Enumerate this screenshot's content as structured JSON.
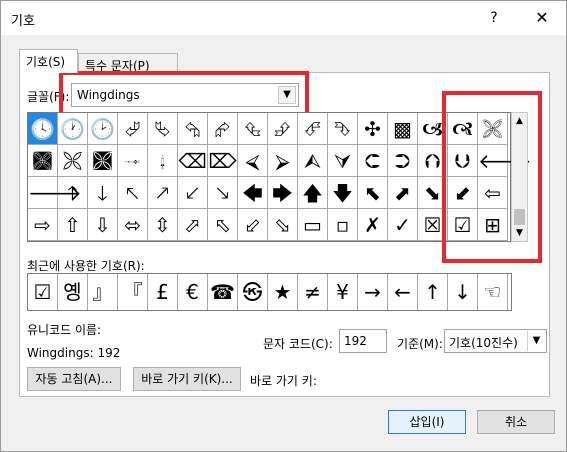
{
  "window": {
    "title": "기호",
    "help_label": "?",
    "close_label": "✕"
  },
  "tabs": [
    {
      "label": "기호(S)"
    },
    {
      "label": "특수 문자(P)"
    }
  ],
  "font": {
    "label": "글꼴(F):",
    "value": "Wingdings"
  },
  "symbol_grid": {
    "selected_index": 0,
    "rows": [
      [
        "🕓",
        "🕐",
        "🕑",
        "⮰",
        "⮱",
        "⮲",
        "⮳",
        "⮴",
        "⮵",
        "⮶",
        "⮷",
        "✣",
        "▩",
        "🙦",
        "🙧",
        "🙨"
      ],
      [
        "🙩",
        "🙪",
        "🙫",
        "🙬",
        "🙭",
        "⌫",
        "⌦",
        "⮘",
        "⮚",
        "⮙",
        "⮛",
        "⮈",
        "⮊",
        "⮉",
        "⮋",
        "🡐"
      ],
      [
        "🡒",
        "🡑",
        "🡓",
        "🡔",
        "🡕",
        "🡗",
        "🡖",
        "🡄",
        "🡆",
        "🡅",
        "🡇",
        "⬉",
        "⬈",
        "⬊",
        "⬋",
        "⇦"
      ],
      [
        "⇨",
        "⇧",
        "⇩",
        "⬄",
        "⇳",
        "⬀",
        "⬁",
        "⬃",
        "⬂",
        "▭",
        "▫",
        "✗",
        "✓",
        "☒",
        "☑",
        "⊞"
      ]
    ]
  },
  "recent": {
    "label": "최근에 사용한 기호(R):",
    "items": [
      "☑",
      "옝",
      "』",
      "『",
      "£",
      "€",
      "☎",
      "㉿",
      "★",
      "≠",
      "¥",
      "→",
      "←",
      "↑",
      "↓",
      "☜"
    ]
  },
  "unicode_name": {
    "label": "유니코드 이름:",
    "value": "Wingdings: 192"
  },
  "char_code": {
    "label": "문자 코드(C):",
    "value": "192"
  },
  "base": {
    "label": "기준(M):",
    "value": "기호(10진수)"
  },
  "buttons": {
    "autocorrect": "자동 고침(A)...",
    "shortcut_key": "바로 가기 키(K)...",
    "shortcut_label": "바로 가기 키:",
    "insert": "삽입(I)",
    "cancel": "취소"
  },
  "colors": {
    "highlight": "#e8282c",
    "selection": "#1e88e5"
  }
}
